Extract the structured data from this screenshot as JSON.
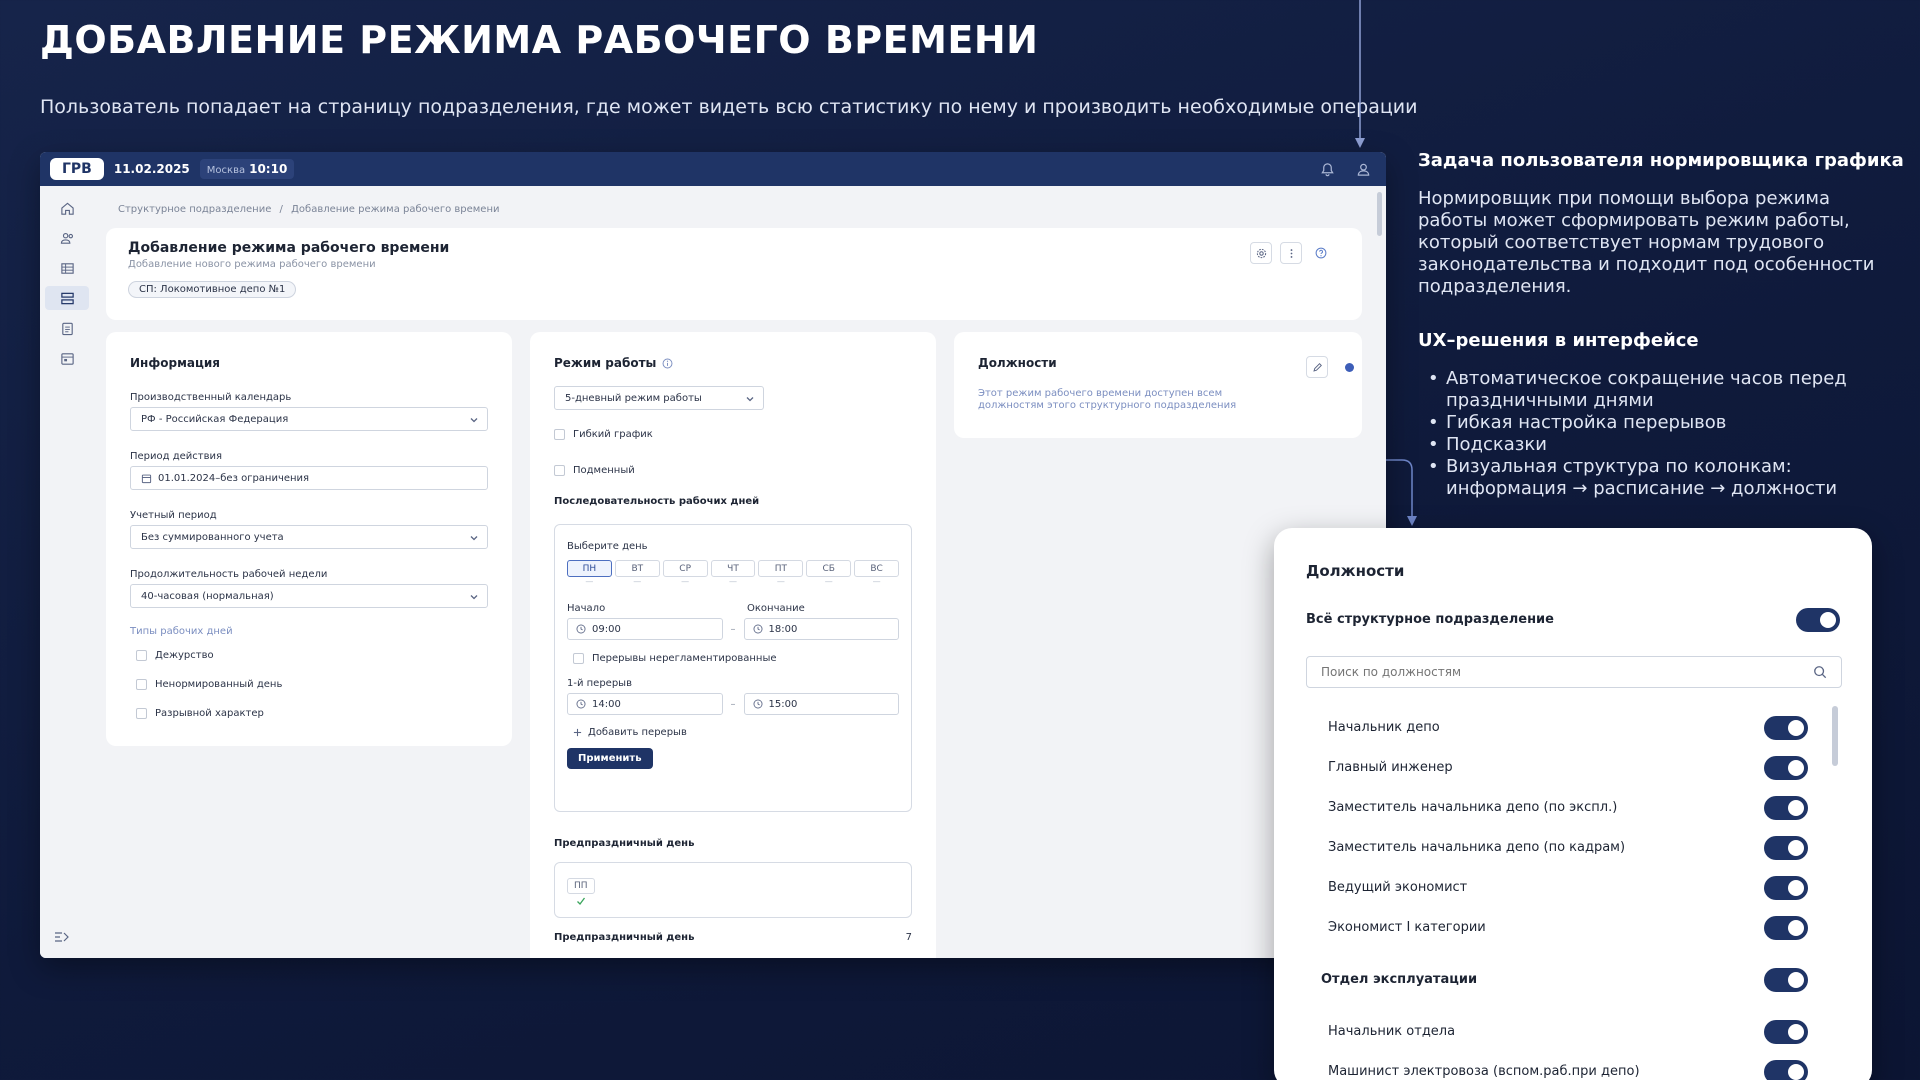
{
  "slide": {
    "title": "ДОБАВЛЕНИЕ РЕЖИМА РАБОЧЕГО ВРЕМЕНИ",
    "subtitle": "Пользователь попадает на страницу подразделения, где может видеть всю статистику по нему и производить необходимые операции"
  },
  "topbar": {
    "logo": "ГРВ",
    "date": "11.02.2025",
    "city": "Москва",
    "time": "10:10"
  },
  "breadcrumb": {
    "parent": "Структурное подразделение",
    "separator": "/",
    "current": "Добавление режима рабочего времени"
  },
  "header": {
    "title": "Добавление режима рабочего времени",
    "subtitle": "Добавление нового режима рабочего времени",
    "chip": "СП: Локомотивное депо №1"
  },
  "info_card": {
    "title": "Информация",
    "calendar_label": "Производственный календарь",
    "calendar_value": "РФ - Российская Федерация",
    "period_label": "Период действия",
    "period_value": "01.01.2024–без ограничения",
    "account_label": "Учетный период",
    "account_value": "Без суммированного учета",
    "week_label": "Продолжительность рабочей недели",
    "week_value": "40-часовая (нормальная)",
    "day_types_label": "Типы рабочих дней",
    "day_types": [
      "Дежурство",
      "Ненормированный день",
      "Разрывной характер"
    ]
  },
  "schedule_card": {
    "title": "Режим работы",
    "mode_value": "5-дневный режим работы",
    "flexible": "Гибкий график",
    "shift": "Подменный",
    "sequence_title": "Последовательность рабочих дней",
    "choose_day": "Выберите день",
    "days": [
      "ПН",
      "ВТ",
      "СР",
      "ЧТ",
      "ПТ",
      "СБ",
      "ВС"
    ],
    "day_dash": "—",
    "start_label": "Начало",
    "end_label": "Окончание",
    "start_value": "09:00",
    "end_value": "18:00",
    "range_dash": "–",
    "breaks_unregulated": "Перерывы нерегламентированные",
    "break1_label": "1-й перерыв",
    "break1_start": "14:00",
    "break1_end": "15:00",
    "add_break": "Добавить перерыв",
    "apply": "Применить",
    "preholiday_title": "Предпраздничный день",
    "preholiday_chip": "ПП",
    "preholiday2_title": "Предпраздничный день",
    "preholiday2_value": "7"
  },
  "positions_card": {
    "title": "Должности",
    "note": "Этот режим рабочего времени доступен всем должностям этого структурного подразделения"
  },
  "right_info": {
    "task_title": "Задача пользователя нормировщика графика",
    "task_lines": [
      "Нормировщик при помощи выбора режима",
      "работы может сформировать режим работы,",
      "который соответствует нормам трудового",
      "законодательства и подходит под особенности",
      "подразделения."
    ],
    "ux_title": "UX–решения в интерфейсе",
    "ux_items": [
      "Автоматическое сокращение часов перед праздничными днями",
      "Гибкая настройка перерывов",
      "Подсказки",
      "Визуальная структура по колонкам: информация → расписание → должности"
    ]
  },
  "panel": {
    "title": "Должности",
    "all_label": "Всё структурное подразделение",
    "search_placeholder": "Поиск по должностям",
    "positions": [
      "Начальник депо",
      "Главный инженер",
      "Заместитель начальника депо (по экспл.)",
      "Заместитель начальника депо (по кадрам)",
      "Ведущий экономист",
      "Экономист I категории"
    ],
    "group": "Отдел эксплуатации",
    "group_positions": [
      "Начальник отдела",
      "Машинист электровоза (вспом.раб.при депо)"
    ]
  },
  "colors": {
    "primary": "#1f3466",
    "background": "#13204a",
    "accent": "#6f86c9"
  }
}
